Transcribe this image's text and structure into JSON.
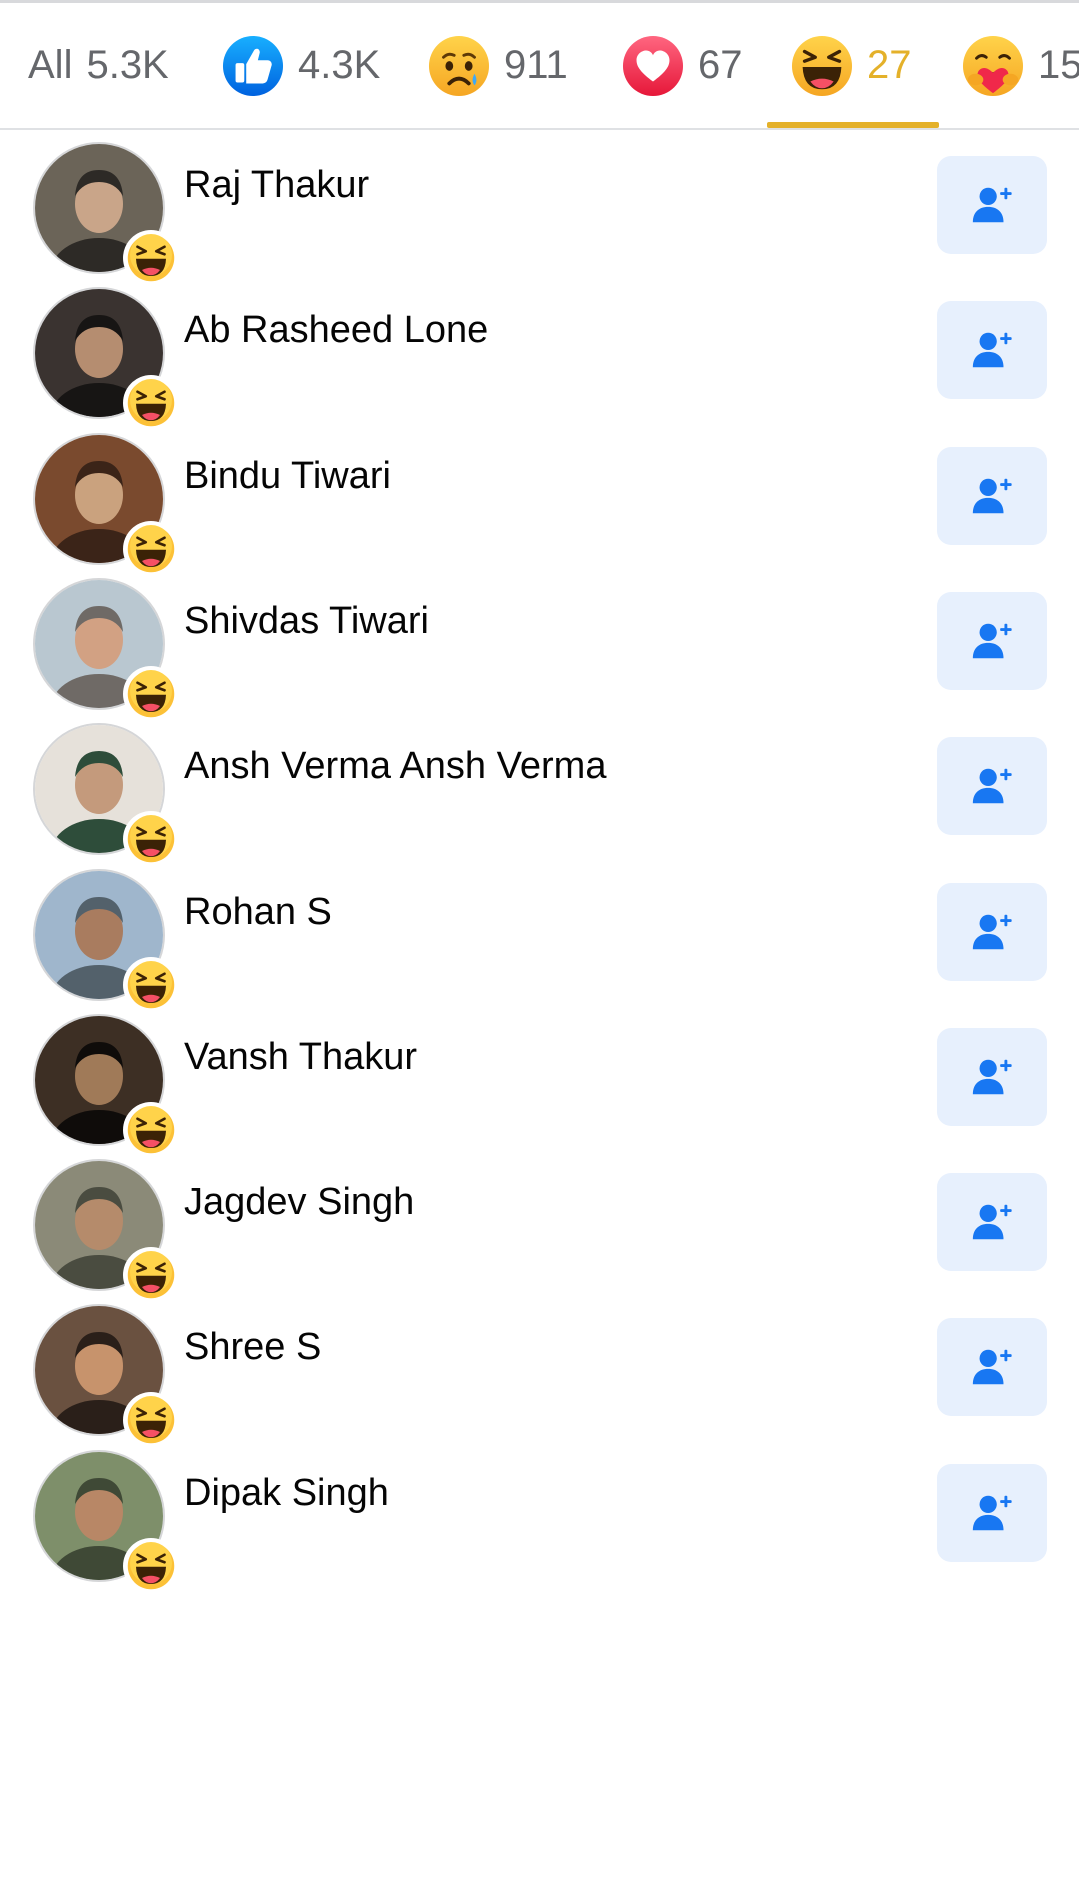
{
  "tabs": [
    {
      "label": "All",
      "count": "5.3K",
      "icon": "none"
    },
    {
      "label": "",
      "count": "4.3K",
      "icon": "like-icon"
    },
    {
      "label": "",
      "count": "911",
      "icon": "sad-icon"
    },
    {
      "label": "",
      "count": "67",
      "icon": "love-icon"
    },
    {
      "label": "",
      "count": "27",
      "icon": "haha-icon",
      "active": true
    },
    {
      "label": "",
      "count": "15",
      "icon": "care-icon"
    }
  ],
  "colors": {
    "accent": "#e4b12a",
    "button_bg": "#e7f0fd",
    "button_icon": "#1877f2",
    "text_secondary": "#65676b"
  },
  "people": [
    {
      "name": "Raj Thakur",
      "reaction": "haha-icon",
      "action_icon": "add-friend-icon"
    },
    {
      "name": "Ab Rasheed Lone",
      "reaction": "haha-icon",
      "action_icon": "add-friend-icon"
    },
    {
      "name": "Bindu Tiwari",
      "reaction": "haha-icon",
      "action_icon": "add-friend-icon"
    },
    {
      "name": "Shivdas Tiwari",
      "reaction": "haha-icon",
      "action_icon": "add-friend-icon"
    },
    {
      "name": "Ansh Verma Ansh Verma",
      "reaction": "haha-icon",
      "action_icon": "add-friend-icon"
    },
    {
      "name": "Rohan S",
      "reaction": "haha-icon",
      "action_icon": "add-friend-icon"
    },
    {
      "name": "Vansh Thakur",
      "reaction": "haha-icon",
      "action_icon": "add-friend-icon"
    },
    {
      "name": "Jagdev Singh",
      "reaction": "haha-icon",
      "action_icon": "add-friend-icon"
    },
    {
      "name": "Shree S",
      "reaction": "haha-icon",
      "action_icon": "add-friend-icon"
    },
    {
      "name": "Dipak Singh",
      "reaction": "haha-icon",
      "action_icon": "add-friend-icon"
    }
  ]
}
